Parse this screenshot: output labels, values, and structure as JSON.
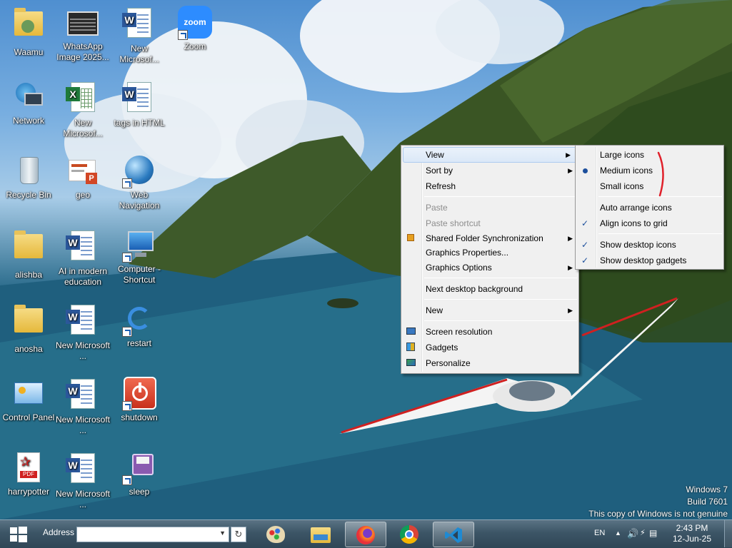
{
  "desktop": {
    "icons": [
      {
        "label": "Waamu",
        "type": "user-folder-icon"
      },
      {
        "label": "WhatsApp Image 2025...",
        "type": "image-file-icon"
      },
      {
        "label": "New Microsof...",
        "type": "word-document-icon"
      },
      {
        "label": "Zoom",
        "type": "zoom-shortcut-icon"
      },
      {
        "label": "Network",
        "type": "network-icon"
      },
      {
        "label": "New Microsof...",
        "type": "excel-document-icon"
      },
      {
        "label": "tags in HTML",
        "type": "word-document-icon"
      },
      {
        "label": "Recycle Bin",
        "type": "recycle-bin-icon"
      },
      {
        "label": "geo",
        "type": "powerpoint-document-icon"
      },
      {
        "label": "Web Navigation",
        "type": "web-globe-shortcut-icon"
      },
      {
        "label": "alishba",
        "type": "folder-icon"
      },
      {
        "label": "AI in modern education",
        "type": "word-document-icon"
      },
      {
        "label": "Computer - Shortcut",
        "type": "computer-shortcut-icon"
      },
      {
        "label": "anosha",
        "type": "folder-icon"
      },
      {
        "label": "New Microsoft ...",
        "type": "word-document-icon"
      },
      {
        "label": "restart",
        "type": "restart-shortcut-icon"
      },
      {
        "label": "Control Panel",
        "type": "control-panel-icon"
      },
      {
        "label": "New Microsoft ...",
        "type": "word-document-icon"
      },
      {
        "label": "shutdown",
        "type": "shutdown-shortcut-icon"
      },
      {
        "label": "harrypotter",
        "type": "pdf-document-icon"
      },
      {
        "label": "New Microsoft ...",
        "type": "word-document-icon"
      },
      {
        "label": "sleep",
        "type": "sleep-shortcut-icon"
      }
    ]
  },
  "context_menu": {
    "items": [
      {
        "label": "View",
        "has_submenu": true,
        "state": "highlighted"
      },
      {
        "label": "Sort by",
        "has_submenu": true
      },
      {
        "label": "Refresh"
      },
      {
        "label": "Paste",
        "disabled": true
      },
      {
        "label": "Paste shortcut",
        "disabled": true
      },
      {
        "label": "Shared Folder Synchronization",
        "has_submenu": true,
        "icon": "sync-folder-icon"
      },
      {
        "label": "Graphics Properties..."
      },
      {
        "label": "Graphics Options",
        "has_submenu": true
      },
      {
        "label": "Next desktop background"
      },
      {
        "label": "New",
        "has_submenu": true
      },
      {
        "label": "Screen resolution",
        "icon": "monitor-icon"
      },
      {
        "label": "Gadgets",
        "icon": "gadgets-icon"
      },
      {
        "label": "Personalize",
        "icon": "personalize-icon"
      }
    ]
  },
  "view_submenu": {
    "items": [
      {
        "label": "Large icons"
      },
      {
        "label": "Medium icons",
        "selected": true
      },
      {
        "label": "Small icons"
      },
      {
        "label": "Auto arrange icons"
      },
      {
        "label": "Align icons to grid",
        "checked": true
      },
      {
        "label": "Show desktop icons",
        "checked": true
      },
      {
        "label": "Show desktop gadgets",
        "checked": true
      }
    ],
    "annotation": "red-bracket-mark"
  },
  "taskbar": {
    "start_icon": "windows-logo-icon",
    "address_label": "Address",
    "address_value": "",
    "pinned": [
      {
        "name": "paint-icon"
      },
      {
        "name": "file-explorer-icon"
      },
      {
        "name": "firefox-icon",
        "active": true
      },
      {
        "name": "chrome-icon"
      },
      {
        "name": "vscode-icon",
        "active": true
      }
    ],
    "language": "EN",
    "time": "2:43 PM",
    "date": "12-Jun-25"
  },
  "watermark": {
    "line1": "Windows 7",
    "line2": "Build 7601",
    "line3": "This copy of Windows is not genuine"
  },
  "colors": {
    "menu_bg": "#f0f0f0",
    "menu_highlight": "#dbe8f7",
    "checkmark": "#1c4f9c",
    "annotation_red": "#e0202a"
  }
}
